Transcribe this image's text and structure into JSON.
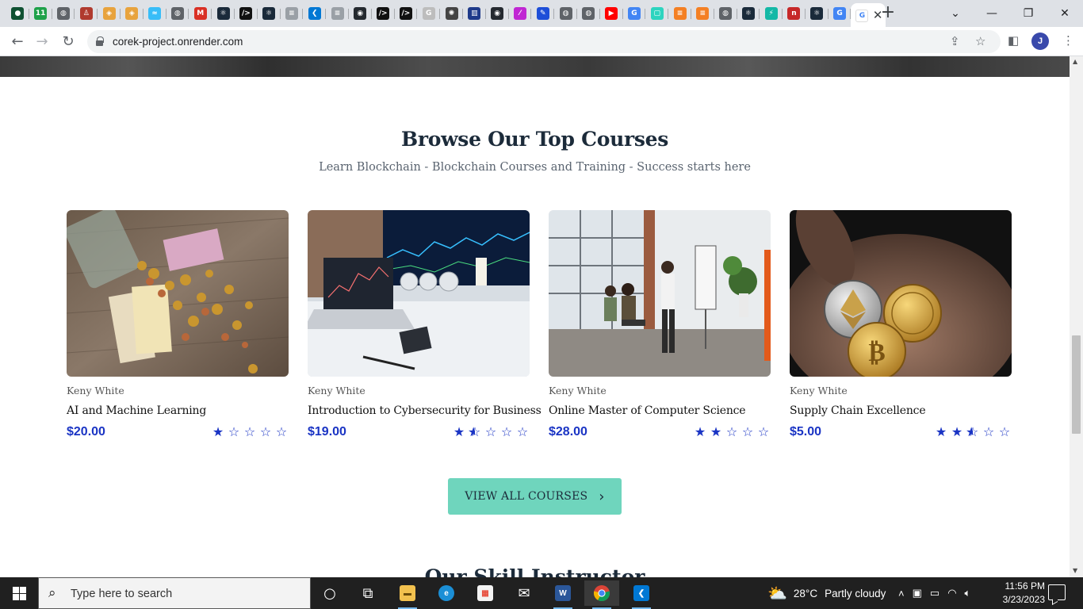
{
  "browser": {
    "tabs": [
      {
        "icon": "green-dot-favicon",
        "glyph": "●",
        "color": "#0f5132"
      },
      {
        "icon": "eleven-favicon",
        "glyph": "11",
        "color": "#1fa14a"
      },
      {
        "icon": "globe-favicon",
        "glyph": "◍",
        "color": "#5f6368"
      },
      {
        "icon": "person-favicon",
        "glyph": "♙",
        "color": "#b03a2e"
      },
      {
        "icon": "stack-favicon",
        "glyph": "◈",
        "color": "#e8a33d"
      },
      {
        "icon": "stack-favicon",
        "glyph": "◈",
        "color": "#e8a33d"
      },
      {
        "icon": "tailwind-favicon",
        "glyph": "≈",
        "color": "#38bdf8"
      },
      {
        "icon": "globe-favicon",
        "glyph": "◍",
        "color": "#5f6368"
      },
      {
        "icon": "gmail-favicon",
        "glyph": "M",
        "color": "#d93025"
      },
      {
        "icon": "react-favicon",
        "glyph": "⚛",
        "color": "#1a2a3a"
      },
      {
        "icon": "terminal-favicon",
        "glyph": "/>",
        "color": "#111111"
      },
      {
        "icon": "react-favicon",
        "glyph": "⚛",
        "color": "#1a2a3a"
      },
      {
        "icon": "stackoverflow-favicon",
        "glyph": "≡",
        "color": "#9aa0a6"
      },
      {
        "icon": "vscode-favicon",
        "glyph": "❮",
        "color": "#0078d4"
      },
      {
        "icon": "stackoverflow-favicon",
        "glyph": "≡",
        "color": "#9aa0a6"
      },
      {
        "icon": "github-favicon",
        "glyph": "◉",
        "color": "#24292f"
      },
      {
        "icon": "terminal-favicon",
        "glyph": "/>",
        "color": "#111111"
      },
      {
        "icon": "terminal-favicon",
        "glyph": "/>",
        "color": "#111111"
      },
      {
        "icon": "google-favicon",
        "glyph": "G",
        "color": "#bdbdbd"
      },
      {
        "icon": "openai-favicon",
        "glyph": "✺",
        "color": "#444444"
      },
      {
        "icon": "bank-favicon",
        "glyph": "▥",
        "color": "#1e3a8a"
      },
      {
        "icon": "github-favicon",
        "glyph": "◉",
        "color": "#24292f"
      },
      {
        "icon": "feather-favicon",
        "glyph": "⁄",
        "color": "#c026d3"
      },
      {
        "icon": "pen-favicon",
        "glyph": "✎",
        "color": "#1d4ed8"
      },
      {
        "icon": "globe-favicon",
        "glyph": "◍",
        "color": "#5f6368"
      },
      {
        "icon": "globe-favicon",
        "glyph": "◍",
        "color": "#5f6368"
      },
      {
        "icon": "youtube-favicon",
        "glyph": "▶",
        "color": "#ff0000"
      },
      {
        "icon": "google-favicon",
        "glyph": "G",
        "color": "#4285f4"
      },
      {
        "icon": "frame-favicon",
        "glyph": "▢",
        "color": "#2dd4bf"
      },
      {
        "icon": "stackoverflow-favicon",
        "glyph": "≡",
        "color": "#f48024"
      },
      {
        "icon": "stackoverflow-favicon",
        "glyph": "≡",
        "color": "#f48024"
      },
      {
        "icon": "globe-favicon",
        "glyph": "◍",
        "color": "#5f6368"
      },
      {
        "icon": "react-favicon",
        "glyph": "⚛",
        "color": "#1a2a3a"
      },
      {
        "icon": "bolt-favicon",
        "glyph": "⚡",
        "color": "#14b8a6"
      },
      {
        "icon": "n-favicon",
        "glyph": "n",
        "color": "#c62828"
      },
      {
        "icon": "react-favicon",
        "glyph": "⚛",
        "color": "#1a2a3a"
      },
      {
        "icon": "google-favicon",
        "glyph": "G",
        "color": "#4285f4"
      }
    ],
    "active_tab": {
      "icon": "google-favicon",
      "glyph": "G",
      "color": "#4285f4",
      "close": "✕"
    },
    "new_tab": "+",
    "window_controls": {
      "dropdown": "⌄",
      "minimize": "—",
      "restore": "❐",
      "close": "✕"
    },
    "toolbar": {
      "back": "←",
      "forward": "→",
      "reload": "↻"
    },
    "url": "corek-project.onrender.com",
    "share_icon": "⇪",
    "bookmark_icon": "☆",
    "sidepanel_icon": "◧",
    "profile_initial": "J",
    "menu_icon": "⋮"
  },
  "page": {
    "section_title": "Browse Our Top Courses",
    "section_subtitle": "Learn Blockchain - Blockchain Courses and Training - Success starts here",
    "courses": [
      {
        "author": "Keny White",
        "title": "AI and Machine Learning",
        "price": "$20.00",
        "rating": 1,
        "image": "coins-and-euro-banknotes"
      },
      {
        "author": "Keny White",
        "title": "Introduction to Cybersecurity for Business",
        "price": "$19.00",
        "rating": 1.5,
        "image": "laptop-with-trading-charts"
      },
      {
        "author": "Keny White",
        "title": "Online Master of Computer Science",
        "price": "$28.00",
        "rating": 2,
        "image": "classroom-whiteboard-presentation"
      },
      {
        "author": "Keny White",
        "title": "Supply Chain Excellence",
        "price": "$5.00",
        "rating": 2.5,
        "image": "hand-holding-crypto-coins"
      }
    ],
    "view_all_label": "VIEW ALL COURSES",
    "view_all_icon": "›",
    "next_section_title": "Our Skill Instructor"
  },
  "taskbar": {
    "search_placeholder": "Type here to search",
    "weather": {
      "temp": "28°C",
      "condition": "Partly cloudy"
    },
    "time": "11:56 PM",
    "date": "3/23/2023",
    "apps": [
      {
        "name": "cortana",
        "glyph": "○"
      },
      {
        "name": "task-view",
        "glyph": "⧉"
      },
      {
        "name": "file-explorer",
        "glyph": "▬"
      },
      {
        "name": "edge",
        "glyph": "e"
      },
      {
        "name": "microsoft-store",
        "glyph": "▦"
      },
      {
        "name": "mail",
        "glyph": "✉"
      },
      {
        "name": "word",
        "glyph": "W"
      },
      {
        "name": "chrome",
        "glyph": "◉"
      },
      {
        "name": "vscode",
        "glyph": "❮"
      }
    ]
  }
}
